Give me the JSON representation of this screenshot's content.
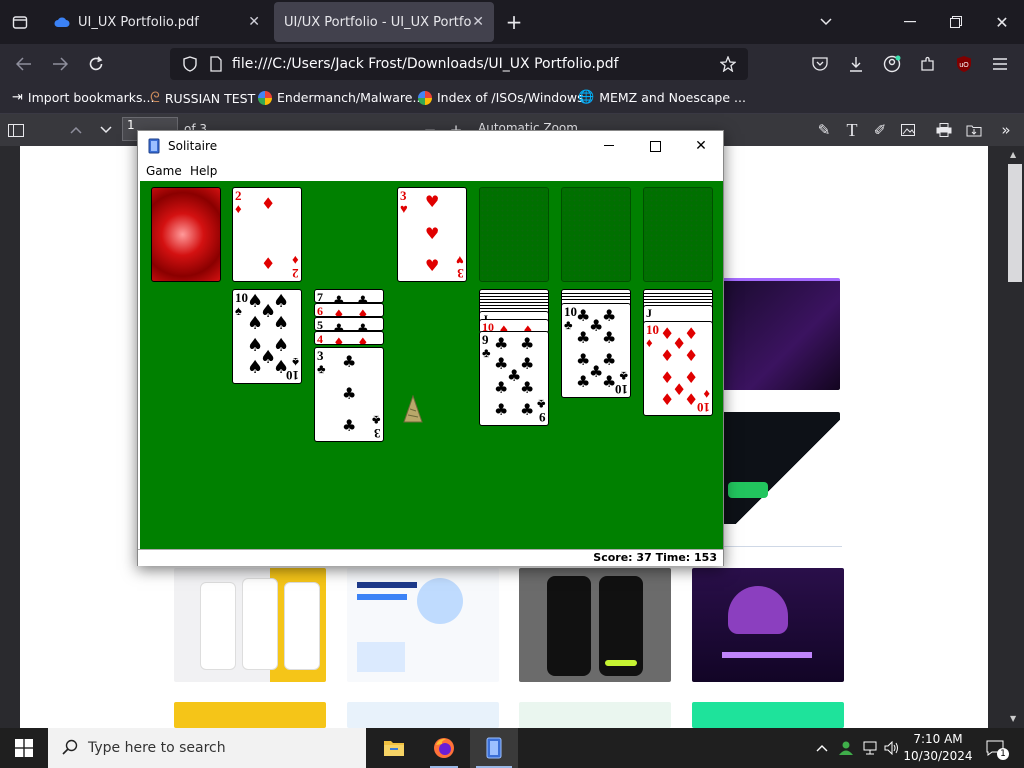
{
  "browser": {
    "tabs": [
      {
        "label": "UI_UX Portfolio.pdf",
        "active": false
      },
      {
        "label": "UI/UX Portfolio - UI_UX Portfolio.pdf",
        "active": true
      }
    ],
    "url": "file:///C:/Users/Jack Frost/Downloads/UI_UX Portfolio.pdf",
    "bookmarks": [
      {
        "label": "Import bookmarks...",
        "icon": "import-icon"
      },
      {
        "label": "RUSSIAN TEST",
        "icon": "site-icon"
      },
      {
        "label": "Endermanch/Malware...",
        "icon": "google-icon"
      },
      {
        "label": "Index of /ISOs/Windows",
        "icon": "google-icon"
      },
      {
        "label": "MEMZ and Noescape ...",
        "icon": "globe-icon"
      }
    ]
  },
  "pdf_toolbar": {
    "page_number": "1",
    "page_count": "of 3",
    "zoom": "Automatic Zoom"
  },
  "solitaire": {
    "title": "Solitaire",
    "menu": [
      "Game",
      "Help"
    ],
    "score_label": "Score:",
    "score": "37",
    "time_label": "Time:",
    "time": "153",
    "waste_card": {
      "rank": "2",
      "suit": "♦"
    },
    "foundations": [
      {
        "rank": "3",
        "suit": "♥",
        "filled": true
      },
      {
        "filled": false
      },
      {
        "filled": false
      },
      {
        "filled": false
      }
    ],
    "tableau": [
      {
        "stack": [],
        "top": {
          "rank": "10",
          "suit": "♠"
        }
      },
      {
        "stack": [
          "7♣",
          "6♦",
          "5♣",
          "4♦"
        ],
        "top": {
          "rank": "3",
          "suit": "♣"
        }
      },
      {
        "stack": [],
        "top": null
      },
      {
        "stack": [
          "J♠",
          "10♦"
        ],
        "top": {
          "rank": "9",
          "suit": "♣"
        }
      },
      {
        "stack": [],
        "top": {
          "rank": "10",
          "suit": "♣"
        }
      },
      {
        "stack": [
          "J♠"
        ],
        "top": {
          "rank": "10",
          "suit": "♦"
        }
      }
    ]
  },
  "taskbar": {
    "search_placeholder": "Type here to search",
    "time": "7:10 AM",
    "date": "10/30/2024",
    "notification_count": "1"
  }
}
